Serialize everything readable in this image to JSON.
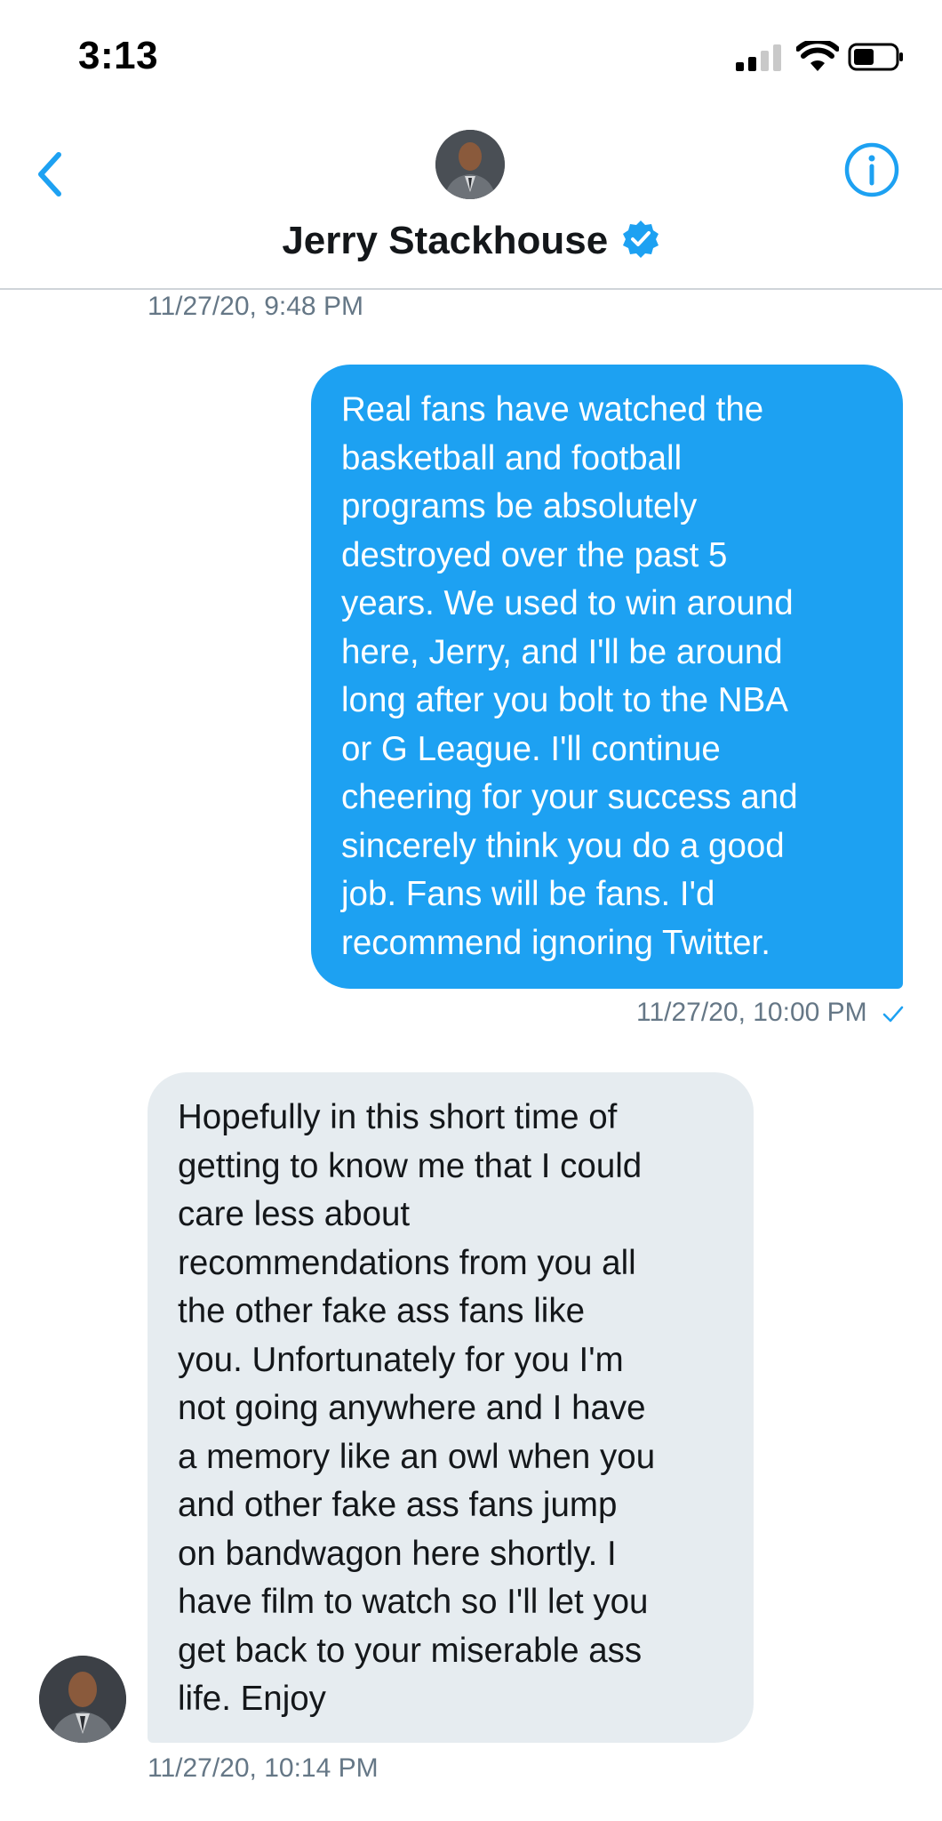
{
  "status_bar": {
    "time": "3:13"
  },
  "header": {
    "contact_name": "Jerry Stackhouse",
    "verified": true,
    "back_icon": "chevron-left-icon",
    "info_icon": "info-icon"
  },
  "conversation": {
    "top_timestamp": "11/27/20, 9:48 PM",
    "sent_message": {
      "text": "Real fans have watched the\nbasketball and football\nprograms be absolutely\ndestroyed over the past 5\nyears. We used to win around\nhere, Jerry,  and I'll be around\nlong after you bolt to the NBA\nor G League. I'll continue\ncheering for your success and\nsincerely think you do a good\njob. Fans will be fans. I'd\nrecommend ignoring Twitter.",
      "timestamp": "11/27/20, 10:00 PM"
    },
    "received_message": {
      "text": "Hopefully in this short time of\ngetting to know me that I could\ncare less about\nrecommendations from you all\nthe other fake ass fans like\nyou. Unfortunately for you I'm\nnot going anywhere and I have\na memory like an owl when you\nand other fake ass fans jump\non bandwagon here shortly. I\nhave film to watch so I'll let you\nget back to your miserable ass\nlife. Enjoy",
      "timestamp": "11/27/20, 10:14 PM"
    }
  },
  "colors": {
    "accent": "#1da1f2",
    "received_bubble": "#e6ecf0",
    "timestamp_text": "#657786"
  }
}
